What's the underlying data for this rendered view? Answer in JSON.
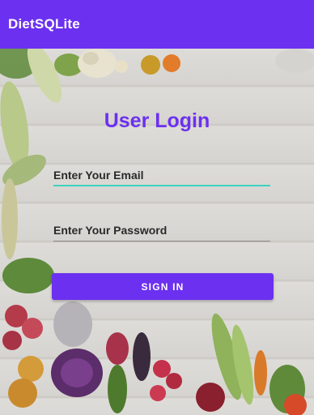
{
  "app_bar": {
    "title": "DietSQLite"
  },
  "login": {
    "title": "User Login",
    "email_placeholder": "Enter Your Email",
    "password_placeholder": "Enter Your Password",
    "sign_in_label": "SIGN IN"
  },
  "colors": {
    "primary": "#6c30f0",
    "email_underline": "#21d0b8",
    "background_wood": "#d9d7d3"
  },
  "background": {
    "image_description_icon": "vegetables-on-wood-icon"
  }
}
